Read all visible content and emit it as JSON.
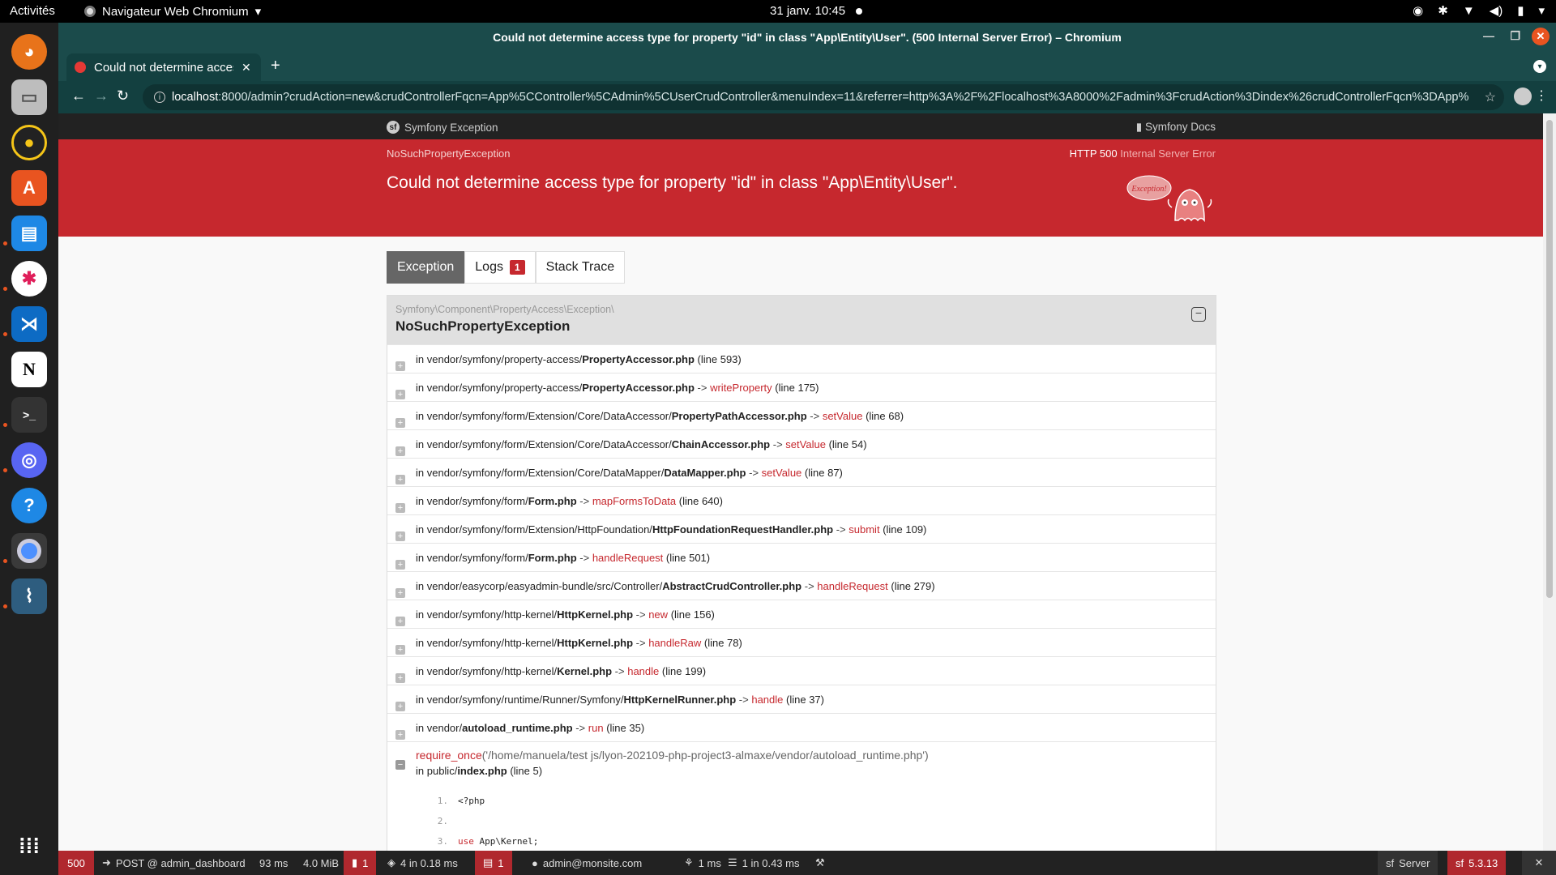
{
  "topbar": {
    "activities": "Activités",
    "app_name": "Navigateur Web Chromium",
    "clock": "31 janv.  10:45"
  },
  "window": {
    "title": "Could not determine access type for property \"id\" in class \"App\\Entity\\User\". (500 Internal Server Error) – Chromium"
  },
  "tab": {
    "label": "Could not determine access type for property"
  },
  "omnibox": {
    "host": "localhost",
    "url_rest": ":8000/admin?crudAction=new&crudControllerFqcn=App%5CController%5CAdmin%5CUserCrudController&menuIndex=11&referrer=http%3A%2F%2Flocalhost%3A8000%2Fadmin%3FcrudAction%3Dindex%26crudControllerFqcn%3DApp%..."
  },
  "sfheader": {
    "brand": "Symfony Exception",
    "docs": "Symfony Docs"
  },
  "exception": {
    "class_short": "NoSuchPropertyException",
    "status_code": "HTTP 500",
    "status_text": "Internal Server Error",
    "message": "Could not determine access type for property \"id\" in class \"App\\Entity\\User\".",
    "ghost_text": "Exception!"
  },
  "tabs": {
    "exception": "Exception",
    "logs": "Logs",
    "logs_count": "1",
    "stack_trace": "Stack Trace"
  },
  "trace": {
    "namespace": "Symfony\\Component\\PropertyAccess\\Exception\\",
    "class": "NoSuchPropertyException",
    "rows": [
      {
        "prefix": "in vendor/symfony/property-access/",
        "file": "PropertyAccessor.php",
        "fn": "",
        "line": "(line 593)"
      },
      {
        "prefix": "in vendor/symfony/property-access/",
        "file": "PropertyAccessor.php",
        "fn": "writeProperty",
        "line": "(line 175)"
      },
      {
        "prefix": "in vendor/symfony/form/Extension/Core/DataAccessor/",
        "file": "PropertyPathAccessor.php",
        "fn": "setValue",
        "line": "(line 68)"
      },
      {
        "prefix": "in vendor/symfony/form/Extension/Core/DataAccessor/",
        "file": "ChainAccessor.php",
        "fn": "setValue",
        "line": "(line 54)"
      },
      {
        "prefix": "in vendor/symfony/form/Extension/Core/DataMapper/",
        "file": "DataMapper.php",
        "fn": "setValue",
        "line": "(line 87)"
      },
      {
        "prefix": "in vendor/symfony/form/",
        "file": "Form.php",
        "fn": "mapFormsToData",
        "line": "(line 640)"
      },
      {
        "prefix": "in vendor/symfony/form/Extension/HttpFoundation/",
        "file": "HttpFoundationRequestHandler.php",
        "fn": "submit",
        "line": "(line 109)"
      },
      {
        "prefix": "in vendor/symfony/form/",
        "file": "Form.php",
        "fn": "handleRequest",
        "line": "(line 501)"
      },
      {
        "prefix": "in vendor/easycorp/easyadmin-bundle/src/Controller/",
        "file": "AbstractCrudController.php",
        "fn": "handleRequest",
        "line": "(line 279)"
      },
      {
        "prefix": "in vendor/symfony/http-kernel/",
        "file": "HttpKernel.php",
        "fn": "new",
        "line": "(line 156)"
      },
      {
        "prefix": "in vendor/symfony/http-kernel/",
        "file": "HttpKernel.php",
        "fn": "handleRaw",
        "line": "(line 78)"
      },
      {
        "prefix": "in vendor/symfony/http-kernel/",
        "file": "Kernel.php",
        "fn": "handle",
        "line": "(line 199)"
      },
      {
        "prefix": "in vendor/symfony/runtime/Runner/Symfony/",
        "file": "HttpKernelRunner.php",
        "fn": "handle",
        "line": "(line 37)"
      },
      {
        "prefix": "in vendor/",
        "file": "autoload_runtime.php",
        "fn": "run",
        "line": "(line 35)"
      }
    ],
    "open_row": {
      "fn": "require_once",
      "args": "('/home/manuela/test js/lyon-202109-php-project3-almaxe/vendor/autoload_runtime.php')",
      "prefix": "in public/",
      "file": "index.php",
      "line": "(line 5)",
      "code": [
        {
          "n": "1.",
          "t": "<?php"
        },
        {
          "n": "2.",
          "t": ""
        },
        {
          "n": "3.",
          "kw": "use",
          "t": " App\\Kernel;"
        }
      ]
    }
  },
  "wdt": {
    "status": "500",
    "route": "POST @ admin_dashboard",
    "time": "93 ms",
    "memory": "4.0 MiB",
    "errors": "1",
    "forms": "4 in 0.18 ms",
    "logs": "1",
    "user": "admin@monsite.com",
    "cache": "1 ms",
    "db": "1 in 0.43 ms",
    "server": "Server",
    "version": "5.3.13"
  }
}
